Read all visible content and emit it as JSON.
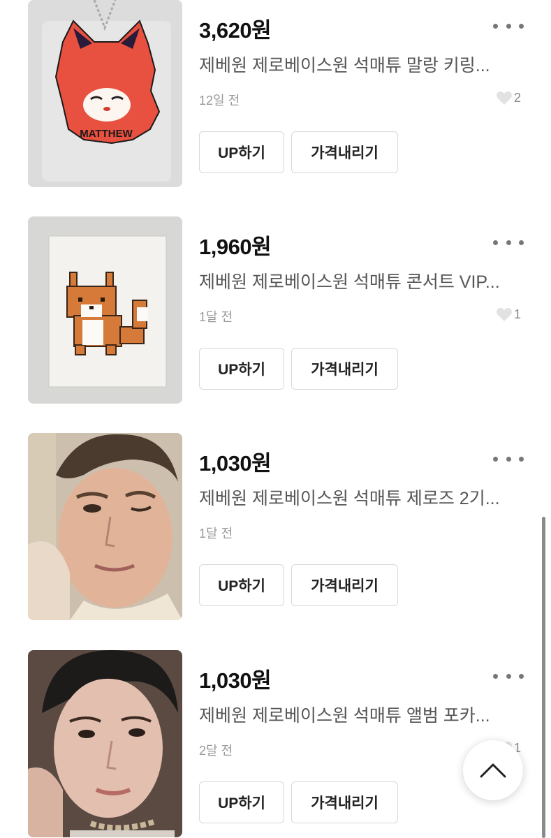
{
  "products": [
    {
      "price": "3,620원",
      "title": "제베원 제로베이스원 석매튜 말랑 키링...",
      "time": "12일 전",
      "likes": "2",
      "image_icon": "fox-keyring",
      "image_text": "MATTHEW"
    },
    {
      "price": "1,960원",
      "title": "제베원 제로베이스원 석매튜 콘서트 VIP...",
      "time": "1달 전",
      "likes": "1",
      "image_icon": "pixel-fox-sticker"
    },
    {
      "price": "1,030원",
      "title": "제베원 제로베이스원 석매튜 제로즈 2기...",
      "time": "1달 전",
      "likes": "",
      "image_icon": "photocard-portrait"
    },
    {
      "price": "1,030원",
      "title": "제베원 제로베이스원 석매튜 앨범 포카...",
      "time": "2달 전",
      "likes": "1",
      "image_icon": "photocard-portrait"
    }
  ],
  "buttons": {
    "up_label": "UP하기",
    "price_down_label": "가격내리기"
  },
  "colors": {
    "price": "#111111",
    "meta": "#999999",
    "keyring": "#e8503f"
  },
  "icons": {
    "more": "more-dots-icon",
    "like": "heart-icon",
    "scroll_top": "chevron-up-icon"
  }
}
